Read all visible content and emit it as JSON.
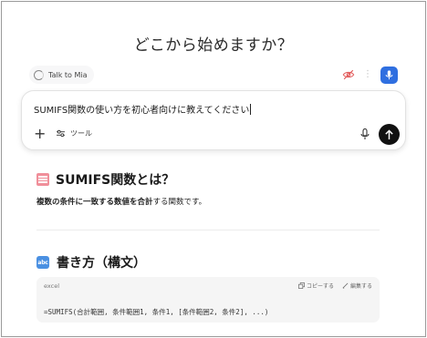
{
  "heading": "どこから始めますか？",
  "mode": {
    "label": "Talk to Mia"
  },
  "prompt": {
    "text": "SUMIFS関数の使い方を初心者向けに教えてください",
    "tools_label": "ツール"
  },
  "section1": {
    "title": "SUMIFS関数とは？",
    "desc_part1": "複数の条件に一致する",
    "desc_part2": "数値を合計",
    "desc_part3": "する関数です。"
  },
  "section2": {
    "title": "書き方（構文）",
    "badge": "abc"
  },
  "code": {
    "language": "excel",
    "copy_label": "コピーする",
    "edit_label": "編集する",
    "line": "=SUMIFS(合計範囲, 条件範囲1, 条件1, [条件範囲2, 条件2], ...)"
  },
  "colors": {
    "accent": "#2f6fe0",
    "send": "#111111",
    "code_bg": "#f5f5f5"
  }
}
